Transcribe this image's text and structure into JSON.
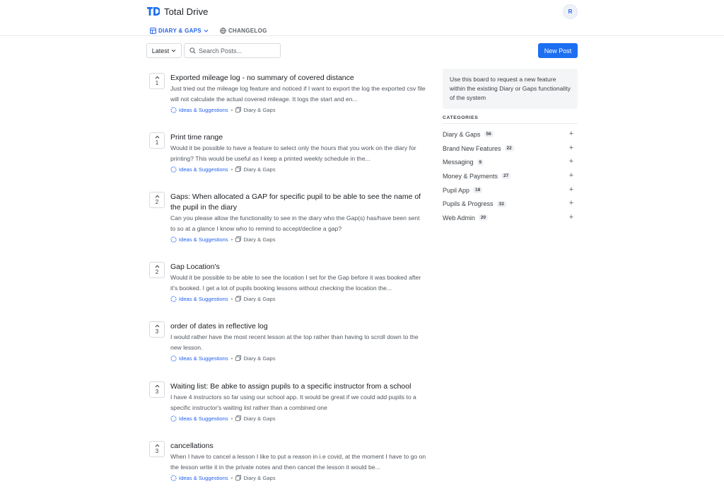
{
  "app": {
    "name": "Total Drive",
    "logo_text": "TD",
    "avatar_initial": "R",
    "accent": "#1d6ff2"
  },
  "tabs": [
    {
      "label": "DIARY & GAPS",
      "icon": "board-icon",
      "active": true
    },
    {
      "label": "CHANGELOG",
      "icon": "globe-icon",
      "active": false
    }
  ],
  "toolbar": {
    "sort_label": "Latest",
    "search_placeholder": "Search Posts...",
    "new_post_label": "New Post"
  },
  "posts": [
    {
      "votes": "1",
      "title": "Exported mileage log - no summary of covered distance",
      "description": "Just tried out the mileage log feature and noticed if I want to export the log the exported csv file will not calculate the actual covered mileage. It logs the start and en...",
      "category": "Ideas & Suggestions",
      "board": "Diary & Gaps"
    },
    {
      "votes": "1",
      "title": "Print time range",
      "description": "Would it be possible to have a feature to select only the hours that you work on the diary for printing? This would be useful as I keep a printed weekly schedule in the...",
      "category": "Ideas & Suggestions",
      "board": "Diary & Gaps"
    },
    {
      "votes": "2",
      "title": "Gaps: When allocated a GAP for specific pupil to be able to see the name of the pupil in the diary",
      "description": "Can you please allow the functionality to see in the diary who the Gap(s) has/have been sent to so at a glance I know who to remind to accept/decline a gap?",
      "category": "Ideas & Suggestions",
      "board": "Diary & Gaps"
    },
    {
      "votes": "2",
      "title": "Gap Location's",
      "description": "Would it be possible to be able to see the location I set for the Gap before it was booked after it's booked. I get a lot of pupils booking lessons without checking the location the...",
      "category": "Ideas & Suggestions",
      "board": "Diary & Gaps"
    },
    {
      "votes": "3",
      "title": "order of dates in reflective log",
      "description": "I would rather have the most recent lesson at the top rather than having to scroll down to the new lesson.",
      "category": "Ideas & Suggestions",
      "board": "Diary & Gaps"
    },
    {
      "votes": "3",
      "title": "Waiting list: Be abke to assign pupils to a specific instructor from a school",
      "description": "I have 4 instructors so far using our school app. It would be great if we could add pupils to a specific instructor's waiting list rather than a combined one",
      "category": "Ideas & Suggestions",
      "board": "Diary & Gaps"
    },
    {
      "votes": "3",
      "title": "cancellations",
      "description": "When I have to cancel a lesson I like to put a reason in i.e covid, at the moment I have to go on the lesson write it in the private notes and then cancel the lesson it would be...",
      "category": "Ideas & Suggestions",
      "board": "Diary & Gaps"
    }
  ],
  "sidebar": {
    "info_text": "Use this board to request a new feature within the existing Diary or Gaps functionality of the system",
    "categories_heading": "CATEGORIES",
    "categories": [
      {
        "name": "Diary & Gaps",
        "count": "56"
      },
      {
        "name": "Brand New Features",
        "count": "22"
      },
      {
        "name": "Messaging",
        "count": "9"
      },
      {
        "name": "Money & Payments",
        "count": "27"
      },
      {
        "name": "Pupil App",
        "count": "18"
      },
      {
        "name": "Pupils & Progress",
        "count": "33"
      },
      {
        "name": "Web Admin",
        "count": "20"
      }
    ],
    "plus_symbol": "+"
  },
  "meta_separator": "•"
}
